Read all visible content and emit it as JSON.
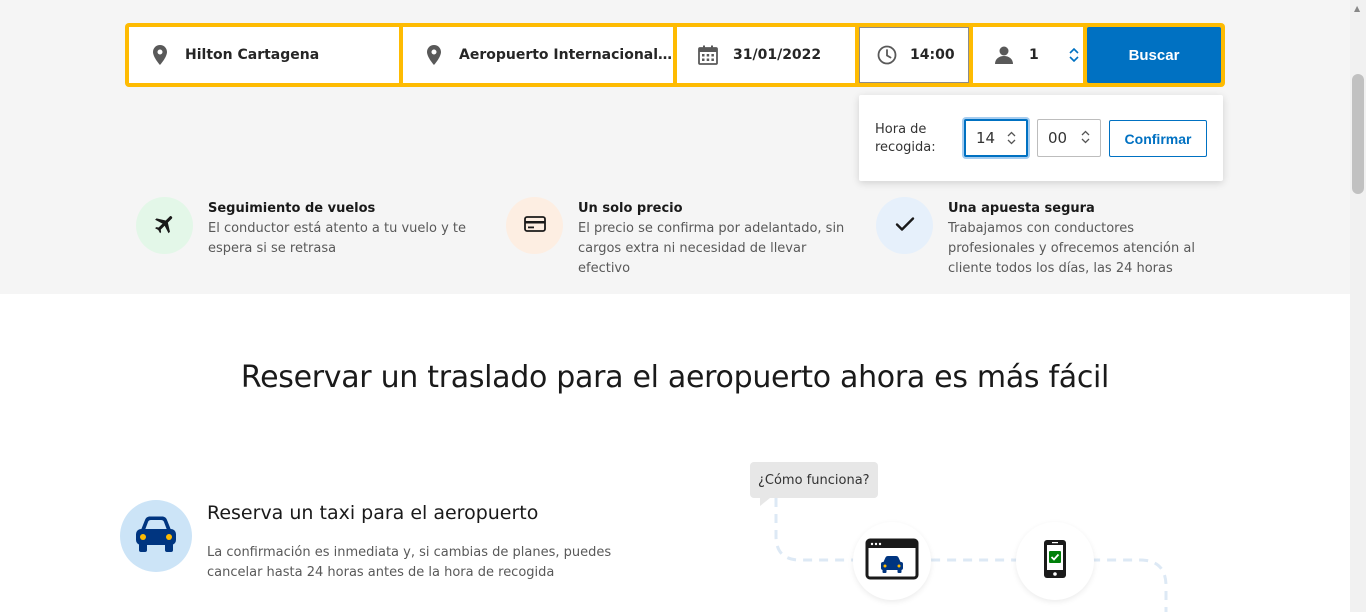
{
  "search": {
    "from": "Hilton Cartagena",
    "to": "Aeropuerto Internacional Ra...",
    "date": "31/01/2022",
    "time": "14:00",
    "passengers": "1",
    "search_label": "Buscar"
  },
  "time_popup": {
    "label": "Hora de recogida:",
    "hour": "14",
    "minute": "00",
    "confirm_label": "Confirmar"
  },
  "features": [
    {
      "title": "Seguimiento de vuelos",
      "desc": "El conductor está atento a tu vuelo y te espera si se retrasa",
      "icon": "airplane-icon"
    },
    {
      "title": "Un solo precio",
      "desc": "El precio se confirma por adelantado, sin cargos extra ni necesidad de llevar efectivo",
      "icon": "credit-card-icon"
    },
    {
      "title": "Una apuesta segura",
      "desc": "Trabajamos con conductores profesionales y ofrecemos atención al cliente todos los días, las 24 horas",
      "icon": "checkmark-icon"
    }
  ],
  "heading": "Reservar un traslado para el aeropuerto ahora es más fácil",
  "taxi": {
    "title": "Reserva un taxi para el aeropuerto",
    "desc": "La confirmación es inmediata y, si cambias de planes, puedes cancelar hasta 24 horas antes de la hora de recogida"
  },
  "how_it_works": {
    "label": "¿Cómo funciona?"
  },
  "colors": {
    "brand_blue": "#0071c2",
    "search_yellow": "#febb02"
  }
}
